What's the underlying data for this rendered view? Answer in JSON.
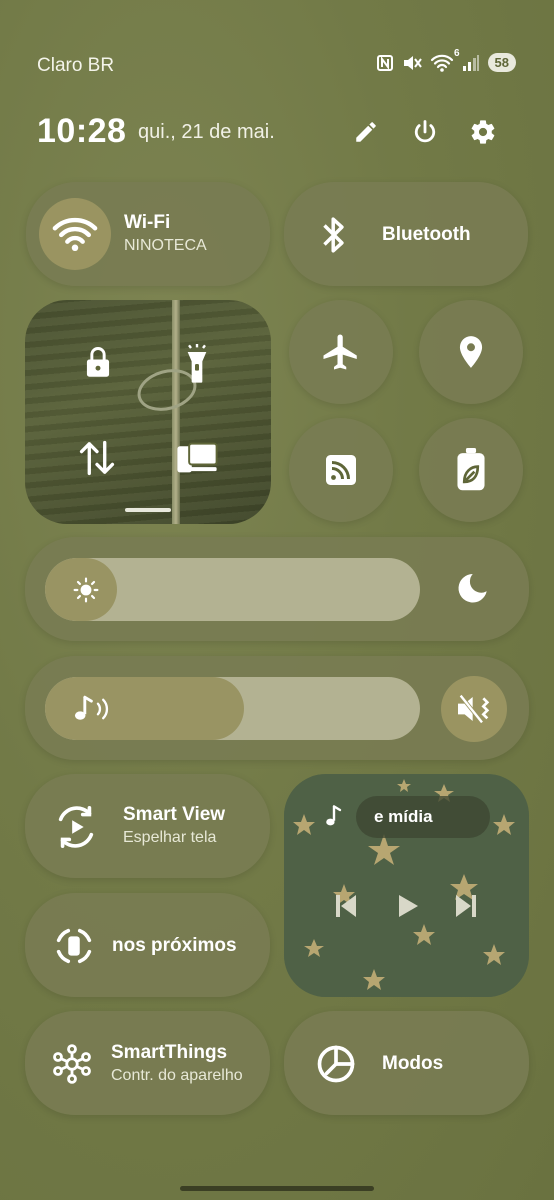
{
  "status_bar": {
    "carrier": "Claro BR",
    "battery": "58",
    "network": "6",
    "icons": [
      "nfc-icon",
      "vibrate-mute-icon",
      "wifi-6-icon",
      "signal-icon"
    ]
  },
  "header": {
    "time": "10:28",
    "date": "qui., 21 de mai.",
    "icons": [
      "edit-icon",
      "power-icon",
      "settings-icon"
    ]
  },
  "tiles": {
    "wifi": {
      "title": "Wi-Fi",
      "subtitle": "NINOTECA",
      "active": true
    },
    "bluetooth": {
      "title": "Bluetooth",
      "active": false
    },
    "smart_view": {
      "title": "Smart View",
      "subtitle": "Espelhar tela"
    },
    "nearby": {
      "title": "nos próximos"
    },
    "smartthings": {
      "title": "SmartThings",
      "subtitle": "Contr. do aparelho"
    },
    "modes": {
      "title": "Modos"
    },
    "media": {
      "label": "e mídia"
    }
  },
  "sliders": {
    "brightness_level": 0.1,
    "volume_level": 0.53
  },
  "colors": {
    "background": "#727a47",
    "tile": "#787c52",
    "active_accent": "#9a9461"
  }
}
